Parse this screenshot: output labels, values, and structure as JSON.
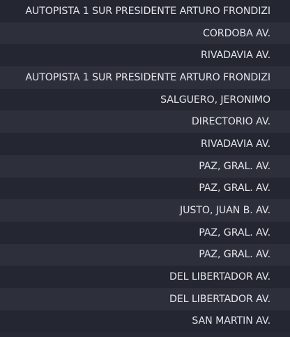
{
  "list": {
    "items": [
      "AUTOPISTA 1 SUR PRESIDENTE ARTURO FRONDIZI",
      "CORDOBA AV.",
      "RIVADAVIA AV.",
      "AUTOPISTA 1 SUR PRESIDENTE ARTURO FRONDIZI",
      "SALGUERO, JERONIMO",
      "DIRECTORIO AV.",
      "RIVADAVIA AV.",
      "PAZ, GRAL. AV.",
      "PAZ, GRAL. AV.",
      "JUSTO, JUAN B. AV.",
      "PAZ, GRAL. AV.",
      "PAZ, GRAL. AV.",
      "DEL LIBERTADOR AV.",
      "DEL LIBERTADOR AV.",
      "SAN MARTIN AV."
    ]
  }
}
